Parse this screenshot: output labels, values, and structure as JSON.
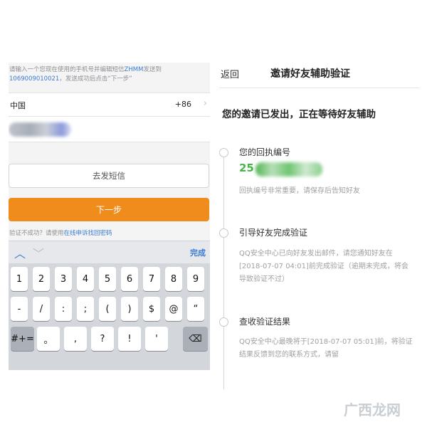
{
  "left": {
    "sms_hint": {
      "line1": "请输入一个您现在使用的手机号并编辑短信",
      "code": "ZHMM",
      "line1_tail": "发送到",
      "number": "1069009010021",
      "line2": "，发送成功后点击“下一步”"
    },
    "country": {
      "name": "中国",
      "code": "+86",
      "chevron": "chevron-right-icon"
    },
    "phone": {
      "value_obscured": true
    },
    "resend_button": "去发短信",
    "next_button": "下一步",
    "fail_hint": {
      "prefix": "验证不成功？请使用",
      "link": "在线申诉找回密码"
    },
    "keyboard_bar": {
      "up": "up-arrow-icon",
      "down": "down-arrow-icon",
      "done": "完成"
    },
    "keyboard": {
      "row1": [
        "1",
        "2",
        "3",
        "4",
        "5",
        "6",
        "7",
        "8",
        "9"
      ],
      "row2": [
        "-",
        "/",
        ":",
        ";",
        "(",
        ")",
        "$",
        "@",
        "“"
      ],
      "row3": [
        "#+=",
        "。",
        ",",
        "?",
        "!",
        "'",
        "⌫"
      ]
    }
  },
  "right": {
    "back": "返回",
    "title": "邀请好友辅助验证",
    "status": "您的邀请已发出，正在等待好友辅助",
    "steps": [
      {
        "title": "您的回执编号",
        "receipt_prefix": "25",
        "desc": "回执编号非常重要，请保存后告知好友"
      },
      {
        "title": "引导好友完成验证",
        "desc": "QQ安全中心已向好友发出邮件，请您通知好友在[2018-07-07 04:01]前完成验证（逾期未完成，将会导致验证不过）"
      },
      {
        "title": "查收验证结果",
        "desc": "QQ安全中心最晚将于[2018-07-07 05:01]前，将验证结果反馈到您的联系方式，请留"
      }
    ]
  },
  "watermark": "广西龙网",
  "colors": {
    "accent_orange": "#f08c1c",
    "link_blue": "#3a7bd5",
    "receipt_green": "#46b548"
  }
}
